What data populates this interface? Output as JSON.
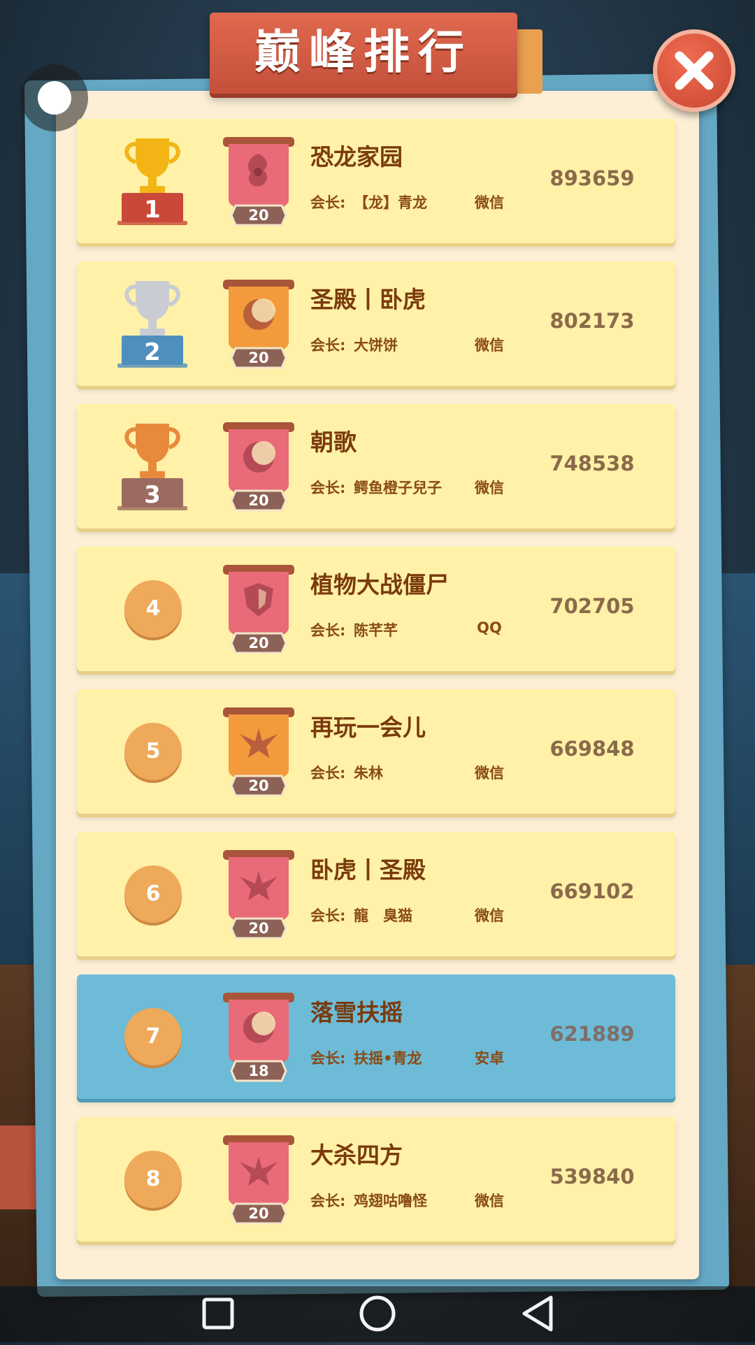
{
  "title": "巅峰排行",
  "leader_label": "会长:",
  "rows": [
    {
      "rank": "1",
      "name": "恐龙家园",
      "level": "20",
      "leader": "【龙】青龙",
      "platform": "微信",
      "score": "893659",
      "emblem": "dragon-crest-icon",
      "banner_color": "red",
      "badge": "gold-trophy"
    },
    {
      "rank": "2",
      "name": "圣殿丨卧虎",
      "level": "20",
      "leader": "大饼饼",
      "platform": "微信",
      "score": "802173",
      "emblem": "crescent-moon-icon",
      "banner_color": "orange",
      "badge": "silver-trophy"
    },
    {
      "rank": "3",
      "name": "朝歌",
      "level": "20",
      "leader": "鳄鱼橙子兒子",
      "platform": "微信",
      "score": "748538",
      "emblem": "crescent-moon-icon",
      "banner_color": "red",
      "badge": "bronze-trophy"
    },
    {
      "rank": "4",
      "name": "植物大战僵尸",
      "level": "20",
      "leader": "陈芊芊",
      "platform": "QQ",
      "score": "702705",
      "emblem": "shield-icon",
      "banner_color": "red",
      "badge": "circle"
    },
    {
      "rank": "5",
      "name": "再玩一会儿",
      "level": "20",
      "leader": "朱林",
      "platform": "微信",
      "score": "669848",
      "emblem": "eagle-icon",
      "banner_color": "orange",
      "badge": "circle"
    },
    {
      "rank": "6",
      "name": "卧虎丨圣殿",
      "level": "20",
      "leader": "龍　臭猫",
      "platform": "微信",
      "score": "669102",
      "emblem": "eagle-icon",
      "banner_color": "red",
      "badge": "circle"
    },
    {
      "rank": "7",
      "name": "落雪扶摇",
      "level": "18",
      "leader": "扶摇•青龙",
      "platform": "安卓",
      "score": "621889",
      "emblem": "crescent-moon-icon",
      "banner_color": "red",
      "badge": "circle",
      "highlighted": true
    },
    {
      "rank": "8",
      "name": "大杀四方",
      "level": "20",
      "leader": "鸡翅咕噜怪",
      "platform": "微信",
      "score": "539840",
      "emblem": "eagle-icon",
      "banner_color": "red",
      "badge": "circle"
    }
  ],
  "colors": {
    "row_bg": "#fff1a7",
    "row_highlight": "#6dbbd6",
    "banner_red": "#e96a78",
    "banner_orange": "#f39a3c",
    "gold": "#f2b515",
    "silver": "#c9ccd2",
    "bronze": "#e88a3c"
  }
}
